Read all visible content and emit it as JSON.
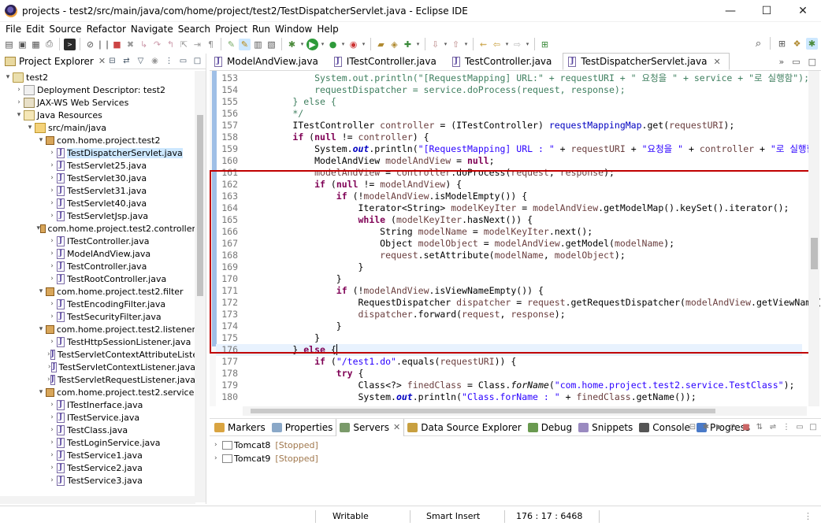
{
  "window": {
    "title": "projects - test2/src/main/java/com/home/project/test2/TestDispatcherServlet.java - Eclipse IDE",
    "minimize": "—",
    "maximize": "☐",
    "close": "✕"
  },
  "menu": [
    "File",
    "Edit",
    "Source",
    "Refactor",
    "Navigate",
    "Search",
    "Project",
    "Run",
    "Window",
    "Help"
  ],
  "explorer": {
    "tab_label": "Project Explorer",
    "tree": [
      {
        "label": "test2",
        "indent": 0,
        "arrow": "▾",
        "icon": "project"
      },
      {
        "label": "Deployment Descriptor: test2",
        "indent": 1,
        "arrow": "›",
        "icon": "desc"
      },
      {
        "label": "JAX-WS Web Services",
        "indent": 1,
        "arrow": "›",
        "icon": "jaxws"
      },
      {
        "label": "Java Resources",
        "indent": 1,
        "arrow": "▾",
        "icon": "jres"
      },
      {
        "label": "src/main/java",
        "indent": 2,
        "arrow": "▾",
        "icon": "srcfolder"
      },
      {
        "label": "com.home.project.test2",
        "indent": 3,
        "arrow": "▾",
        "icon": "package"
      },
      {
        "label": "TestDispatcherServlet.java",
        "indent": 4,
        "arrow": "›",
        "icon": "java",
        "selected": true
      },
      {
        "label": "TestServlet25.java",
        "indent": 4,
        "arrow": "›",
        "icon": "java"
      },
      {
        "label": "TestServlet30.java",
        "indent": 4,
        "arrow": "›",
        "icon": "java"
      },
      {
        "label": "TestServlet31.java",
        "indent": 4,
        "arrow": "›",
        "icon": "java"
      },
      {
        "label": "TestServlet40.java",
        "indent": 4,
        "arrow": "›",
        "icon": "java"
      },
      {
        "label": "TestServletJsp.java",
        "indent": 4,
        "arrow": "›",
        "icon": "java"
      },
      {
        "label": "com.home.project.test2.controller",
        "indent": 3,
        "arrow": "▾",
        "icon": "package"
      },
      {
        "label": "ITestController.java",
        "indent": 4,
        "arrow": "›",
        "icon": "java"
      },
      {
        "label": "ModelAndView.java",
        "indent": 4,
        "arrow": "›",
        "icon": "java"
      },
      {
        "label": "TestController.java",
        "indent": 4,
        "arrow": "›",
        "icon": "java"
      },
      {
        "label": "TestRootController.java",
        "indent": 4,
        "arrow": "›",
        "icon": "java"
      },
      {
        "label": "com.home.project.test2.filter",
        "indent": 3,
        "arrow": "▾",
        "icon": "package"
      },
      {
        "label": "TestEncodingFilter.java",
        "indent": 4,
        "arrow": "›",
        "icon": "java"
      },
      {
        "label": "TestSecurityFilter.java",
        "indent": 4,
        "arrow": "›",
        "icon": "java"
      },
      {
        "label": "com.home.project.test2.listener",
        "indent": 3,
        "arrow": "▾",
        "icon": "package"
      },
      {
        "label": "TestHttpSessionListener.java",
        "indent": 4,
        "arrow": "›",
        "icon": "java"
      },
      {
        "label": "TestServletContextAttributeListe",
        "indent": 4,
        "arrow": "›",
        "icon": "java"
      },
      {
        "label": "TestServletContextListener.java",
        "indent": 4,
        "arrow": "›",
        "icon": "java"
      },
      {
        "label": "TestServletRequestListener.java",
        "indent": 4,
        "arrow": "›",
        "icon": "java"
      },
      {
        "label": "com.home.project.test2.service",
        "indent": 3,
        "arrow": "▾",
        "icon": "package"
      },
      {
        "label": "ITestInerface.java",
        "indent": 4,
        "arrow": "›",
        "icon": "java"
      },
      {
        "label": "ITestService.java",
        "indent": 4,
        "arrow": "›",
        "icon": "java"
      },
      {
        "label": "TestClass.java",
        "indent": 4,
        "arrow": "›",
        "icon": "java"
      },
      {
        "label": "TestLoginService.java",
        "indent": 4,
        "arrow": "›",
        "icon": "java"
      },
      {
        "label": "TestService1.java",
        "indent": 4,
        "arrow": "›",
        "icon": "java"
      },
      {
        "label": "TestService2.java",
        "indent": 4,
        "arrow": "›",
        "icon": "java"
      },
      {
        "label": "TestService3.java",
        "indent": 4,
        "arrow": "›",
        "icon": "java"
      }
    ]
  },
  "editor": {
    "tabs": [
      {
        "label": "ModelAndView.java",
        "active": false
      },
      {
        "label": "ITestController.java",
        "active": false
      },
      {
        "label": "TestController.java",
        "active": false
      },
      {
        "label": "TestDispatcherServlet.java",
        "active": true
      }
    ],
    "lines": [
      {
        "n": "153",
        "html": "            System.<span class='stat'>out</span>.println(<span class='str'>\"[RequestMapping] URL:\"</span> + <span class='var'>requestURI</span> + <span class='str'>\" 요청을 \"</span> + <span class='var'>service</span> + <span class='str'>\"로 실행함\"</span>);",
        "cmt": true
      },
      {
        "n": "154",
        "html": "            requestDispatcher = service.doProcess(request, response);",
        "cmt": true
      },
      {
        "n": "155",
        "html": "        } else {",
        "cmt": true
      },
      {
        "n": "156",
        "html": "        */",
        "cmt": true
      },
      {
        "n": "157",
        "html": "        ITestController <span class='var'>controller</span> = (ITestController) <span class='fld'>requestMappingMap</span>.get(<span class='var'>requestURI</span>);"
      },
      {
        "n": "158",
        "html": "        <span class='kw'>if</span> (<span class='kw'>null</span> != <span class='var'>controller</span>) {"
      },
      {
        "n": "159",
        "html": "            System.<span class='stat'>out</span>.println(<span class='str'>\"[RequestMapping] URL : \"</span> + <span class='var'>requestURI</span> + <span class='str'>\"요청을 \"</span> + <span class='var'>controller</span> + <span class='str'>\"로 실행함\"</span>"
      },
      {
        "n": "160",
        "html": "            ModelAndView <span class='var'>modelAndView</span> = <span class='kw'>null</span>;"
      },
      {
        "n": "161",
        "html": "            <span class='var'>modelAndView</span> = <span class='var'>controller</span>.doProcess(<span class='var'>request</span>, <span class='var'>response</span>);"
      },
      {
        "n": "162",
        "html": "            <span class='kw'>if</span> (<span class='kw'>null</span> != <span class='var'>modelAndView</span>) {"
      },
      {
        "n": "163",
        "html": "                <span class='kw'>if</span> (!<span class='var'>modelAndView</span>.isModelEmpty()) {"
      },
      {
        "n": "164",
        "html": "                    Iterator&lt;String&gt; <span class='var'>modelKeyIter</span> = <span class='var'>modelAndView</span>.getModelMap().keySet().iterator();"
      },
      {
        "n": "165",
        "html": "                    <span class='kw'>while</span> (<span class='var'>modelKeyIter</span>.hasNext()) {"
      },
      {
        "n": "166",
        "html": "                        String <span class='var'>modelName</span> = <span class='var'>modelKeyIter</span>.next();"
      },
      {
        "n": "167",
        "html": "                        Object <span class='var'>modelObject</span> = <span class='var'>modelAndView</span>.getModel(<span class='var'>modelName</span>);"
      },
      {
        "n": "168",
        "html": "                        <span class='var'>request</span>.setAttribute(<span class='var'>modelName</span>, <span class='var'>modelObject</span>);"
      },
      {
        "n": "169",
        "html": "                    }"
      },
      {
        "n": "170",
        "html": "                }"
      },
      {
        "n": "171",
        "html": "                <span class='kw'>if</span> (!<span class='var'>modelAndView</span>.isViewNameEmpty()) {"
      },
      {
        "n": "172",
        "html": "                    RequestDispatcher <span class='var'>dispatcher</span> = <span class='var'>request</span>.getRequestDispatcher(<span class='var'>modelAndView</span>.getViewName("
      },
      {
        "n": "173",
        "html": "                    <span class='var'>dispatcher</span>.forward(<span class='var'>request</span>, <span class='var'>response</span>);"
      },
      {
        "n": "174",
        "html": "                }"
      },
      {
        "n": "175",
        "html": "            }"
      },
      {
        "n": "176",
        "html": "        } <span class='kw'>else</span> {",
        "current": true
      },
      {
        "n": "177",
        "html": "            <span class='kw'>if</span> (<span class='str'>\"/test1.do\"</span>.equals(<span class='var'>requestURI</span>)) {"
      },
      {
        "n": "178",
        "html": "                <span class='kw'>try</span> {"
      },
      {
        "n": "179",
        "html": "                    Class&lt;?&gt; <span class='var'>finedClass</span> = Class.<i>forName</i>(<span class='str'>\"com.home.project.test2.service.TestClass\"</span>);"
      },
      {
        "n": "180",
        "html": "                    System.<span class='stat'>out</span>.println(<span class='str'>\"Class.forName : \"</span> + <span class='var'>finedClass</span>.getName());"
      }
    ]
  },
  "bottom": {
    "tabs": [
      {
        "label": "Markers",
        "color": "#d9a441"
      },
      {
        "label": "Properties",
        "color": "#8aa8c8"
      },
      {
        "label": "Servers",
        "color": "#7a9a6a",
        "active": true
      },
      {
        "label": "Data Source Explorer",
        "color": "#c8a040"
      },
      {
        "label": "Debug",
        "color": "#6a9a50"
      },
      {
        "label": "Snippets",
        "color": "#9a8ac0"
      },
      {
        "label": "Console",
        "color": "#555555"
      },
      {
        "label": "Progress",
        "color": "#4a7ac8"
      }
    ],
    "servers": [
      {
        "name": "Tomcat8",
        "state": "[Stopped]"
      },
      {
        "name": "Tomcat9",
        "state": "[Stopped]"
      }
    ]
  },
  "status": {
    "writable": "Writable",
    "insert_mode": "Smart Insert",
    "position": "176 : 17 : 6468"
  }
}
